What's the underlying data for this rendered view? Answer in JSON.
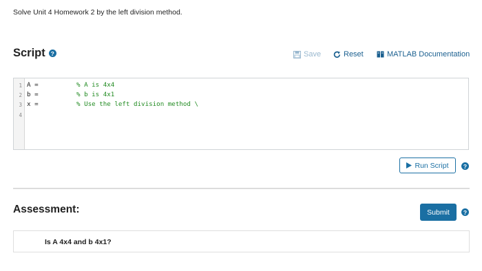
{
  "instructions": "Solve Unit 4 Homework 2 by the left division method.",
  "script": {
    "title": "Script",
    "help_glyph": "?",
    "save_label": "Save",
    "reset_label": "Reset",
    "doc_label": "MATLAB Documentation"
  },
  "editor": {
    "lines": [
      {
        "num": "1",
        "code": "A =",
        "comment": "% A is 4x4"
      },
      {
        "num": "2",
        "code": "b =",
        "comment": "% b is 4x1"
      },
      {
        "num": "3",
        "code": "x =",
        "comment": "% Use the left division method \\"
      },
      {
        "num": "4",
        "code": "",
        "comment": ""
      }
    ]
  },
  "run": {
    "label": "Run Script",
    "help_glyph": "?"
  },
  "assessment": {
    "title": "Assessment:",
    "submit_label": "Submit",
    "help_glyph": "?",
    "question": "Is A 4x4 and b 4x1?"
  },
  "colors": {
    "accent": "#1a6fa3",
    "comment": "#228b22",
    "save_disabled": "#9ab8cf"
  },
  "icons": {
    "save": "save-icon",
    "reset": "reset-icon",
    "doc": "book-icon",
    "run": "play-icon",
    "help": "help-icon"
  }
}
